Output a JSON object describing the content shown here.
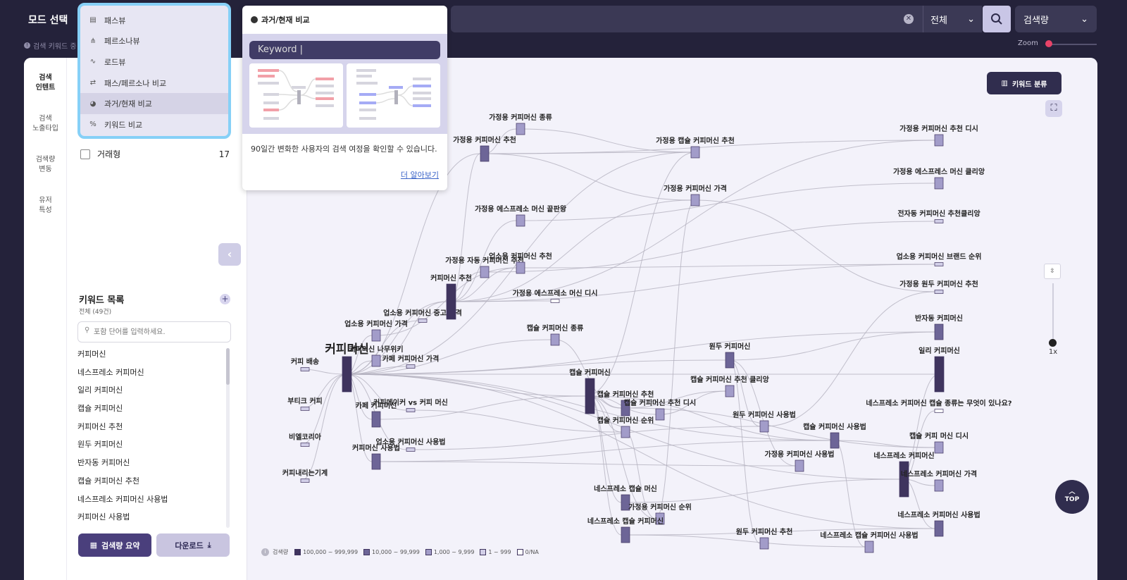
{
  "topbar": {
    "mode_title": "모드 선택",
    "hint": "검색 키워드 중",
    "scope": "전체",
    "metric": "검색량",
    "zoom_label": "Zoom"
  },
  "rail": [
    "검색\n인텐트",
    "검색\n노출타입",
    "검색량\n변동",
    "유저\n특성"
  ],
  "mode_menu": [
    {
      "label": "패스뷰",
      "icon": "path-view-icon"
    },
    {
      "label": "페르소나뷰",
      "icon": "persona-view-icon"
    },
    {
      "label": "로드뷰",
      "icon": "road-view-icon"
    },
    {
      "label": "패스/페르소나 비교",
      "icon": "compare-icon"
    },
    {
      "label": "과거/현재 비교",
      "icon": "history-icon"
    },
    {
      "label": "키워드 비교",
      "icon": "keyword-compare-icon"
    }
  ],
  "popover": {
    "title": "과거/현재 비교",
    "input": "Keyword |",
    "description": "90일간 변화한 사용자의 검색 여정을 확인할 수 있습니다.",
    "link": "더 알아보기"
  },
  "filter": {
    "label": "거래형",
    "count": "17"
  },
  "keywords": {
    "title": "키워드 목록",
    "subtitle": "전체 (49건)",
    "search_placeholder": "포함 단어를 입력하세요.",
    "items": [
      "커피머신",
      "네스프레소 커피머신",
      "일리 커피머신",
      "캡슐 커피머신",
      "커피머신 추천",
      "원두 커피머신",
      "반자동 커피머신",
      "캡슐 커피머신 추천",
      "네스프레소 커피머신 사용법",
      "커피머신 사용법"
    ]
  },
  "buttons": {
    "summary": "검색량 요약",
    "download": "다운로드"
  },
  "graph": {
    "classify_button": "키워드 분류",
    "zoom_value": "1x",
    "top_button": "TOP",
    "legend_title": "검색량",
    "legend": [
      {
        "label": "100,000 ~ 999,999",
        "color": "#3f345e"
      },
      {
        "label": "10,000 ~ 99,999",
        "color": "#6d6597"
      },
      {
        "label": "1,000 ~ 9,999",
        "color": "#a29cc9"
      },
      {
        "label": "1 ~ 999",
        "color": "#d1cee7"
      },
      {
        "label": "0/NA",
        "color": "#ffffff"
      }
    ],
    "nodes": [
      {
        "id": "n0",
        "label": "커피머신",
        "level": 0
      },
      {
        "id": "n1",
        "label": "커피 배송",
        "level": 3
      },
      {
        "id": "n2",
        "label": "부티크 커피",
        "level": 3
      },
      {
        "id": "n3",
        "label": "비엘코리아",
        "level": 3
      },
      {
        "id": "n4",
        "label": "커피내리는기계",
        "level": 3
      },
      {
        "id": "n5",
        "label": "업소용 커피머신 중고 가격",
        "level": 3
      },
      {
        "id": "n6",
        "label": "업소용 커피머신 가격",
        "level": 2
      },
      {
        "id": "n7",
        "label": "커피머신 나무위키",
        "level": 2
      },
      {
        "id": "n8",
        "label": "카페 커피머신 가격",
        "level": 3
      },
      {
        "id": "n9",
        "label": "커피메이커 vs 커피 머신",
        "level": 3
      },
      {
        "id": "n10",
        "label": "카페 커피머신",
        "level": 1
      },
      {
        "id": "n11",
        "label": "업소용 커피머신 사용법",
        "level": 3
      },
      {
        "id": "n12",
        "label": "커피머신 사용법",
        "level": 1
      },
      {
        "id": "n13",
        "label": "커피머신 추천",
        "level": 0
      },
      {
        "id": "n14",
        "label": "가정용 자동 커피머신 추천",
        "level": 2
      },
      {
        "id": "n15",
        "label": "업소용 커피머신 추천",
        "level": 2
      },
      {
        "id": "n16",
        "label": "가정용 에스프레소 머신 끝판왕",
        "level": 2
      },
      {
        "id": "n17",
        "label": "가정용 에스프레소 머신 디시",
        "level": 4
      },
      {
        "id": "n18",
        "label": "가정용 커피머신 추천",
        "level": 1
      },
      {
        "id": "n19",
        "label": "가정용 커피머신 종류",
        "level": 2
      },
      {
        "id": "n20",
        "label": "가정용 캡슐 커피머신 추천",
        "level": 2
      },
      {
        "id": "n21",
        "label": "가정용 커피머신 가격",
        "level": 2
      },
      {
        "id": "n22",
        "label": "캡슐 커피머신 종류",
        "level": 2
      },
      {
        "id": "n23",
        "label": "캡슐 커피머신",
        "level": 0
      },
      {
        "id": "n24",
        "label": "캡슐 커피머신 추천",
        "level": 1
      },
      {
        "id": "n25",
        "label": "캡슐 커피머신 추천 디시",
        "level": 2
      },
      {
        "id": "n26",
        "label": "캡슐 커피머신 순위",
        "level": 2
      },
      {
        "id": "n27",
        "label": "원두 커피머신",
        "level": 1
      },
      {
        "id": "n28",
        "label": "캡슐 커피머신 추천 클리앙",
        "level": 2
      },
      {
        "id": "n29",
        "label": "원두 커피머신 사용법",
        "level": 2
      },
      {
        "id": "n30",
        "label": "캡슐 커피머신 사용법",
        "level": 1
      },
      {
        "id": "n31",
        "label": "가정용 커피머신 사용법",
        "level": 2
      },
      {
        "id": "n32",
        "label": "네스프레소 캡슐 머신",
        "level": 1
      },
      {
        "id": "n33",
        "label": "가정용 커피머신 순위",
        "level": 2
      },
      {
        "id": "n34",
        "label": "네스프레소 캡슐 커피머신",
        "level": 1
      },
      {
        "id": "n35",
        "label": "원두 커피머신 추천",
        "level": 2
      },
      {
        "id": "n36",
        "label": "네스프레소 캡슐 커피머신 사용법",
        "level": 2
      },
      {
        "id": "n37",
        "label": "가정용 커피머신 추천 디시",
        "level": 2
      },
      {
        "id": "n38",
        "label": "가정용 에스프레스 머신 클리앙",
        "level": 2
      },
      {
        "id": "n39",
        "label": "전자동 커피머신 추천클리앙",
        "level": 3
      },
      {
        "id": "n40",
        "label": "업소용 커피머신 브랜드 순위",
        "level": 3
      },
      {
        "id": "n41",
        "label": "가정용 원두 커피머신 추천",
        "level": 3
      },
      {
        "id": "n42",
        "label": "반자동 커피머신",
        "level": 1
      },
      {
        "id": "n43",
        "label": "일리 커피머신",
        "level": 0
      },
      {
        "id": "n44",
        "label": "네스프레소 커피머신 캡슐 종류는 무엇이 있나요?",
        "level": 4
      },
      {
        "id": "n45",
        "label": "캡슐 커피 머신 디시",
        "level": 2
      },
      {
        "id": "n46",
        "label": "네스프레소 커피머신",
        "level": 0
      },
      {
        "id": "n47",
        "label": "네스프레소 커피머신 가격",
        "level": 2
      },
      {
        "id": "n48",
        "label": "네스프레소 커피머신 사용법",
        "level": 1
      }
    ],
    "links": [
      [
        "n0",
        "n1"
      ],
      [
        "n0",
        "n2"
      ],
      [
        "n0",
        "n3"
      ],
      [
        "n0",
        "n4"
      ],
      [
        "n0",
        "n5"
      ],
      [
        "n0",
        "n6"
      ],
      [
        "n0",
        "n7"
      ],
      [
        "n0",
        "n8"
      ],
      [
        "n0",
        "n9"
      ],
      [
        "n0",
        "n10"
      ],
      [
        "n0",
        "n11"
      ],
      [
        "n0",
        "n12"
      ],
      [
        "n0",
        "n13"
      ],
      [
        "n0",
        "n23"
      ],
      [
        "n0",
        "n27"
      ],
      [
        "n0",
        "n42"
      ],
      [
        "n0",
        "n43"
      ],
      [
        "n0",
        "n46"
      ],
      [
        "n0",
        "n18"
      ],
      [
        "n0",
        "n20"
      ],
      [
        "n0",
        "n22"
      ],
      [
        "n0",
        "n30"
      ],
      [
        "n0",
        "n48"
      ],
      [
        "n13",
        "n14"
      ],
      [
        "n13",
        "n15"
      ],
      [
        "n13",
        "n16"
      ],
      [
        "n13",
        "n18"
      ],
      [
        "n13",
        "n17"
      ],
      [
        "n13",
        "n21"
      ],
      [
        "n13",
        "n37"
      ],
      [
        "n13",
        "n40"
      ],
      [
        "n18",
        "n19"
      ],
      [
        "n18",
        "n20"
      ],
      [
        "n18",
        "n21"
      ],
      [
        "n18",
        "n37"
      ],
      [
        "n19",
        "n20"
      ],
      [
        "n16",
        "n38"
      ],
      [
        "n14",
        "n39"
      ],
      [
        "n15",
        "n40"
      ],
      [
        "n21",
        "n41"
      ],
      [
        "n23",
        "n24"
      ],
      [
        "n23",
        "n25"
      ],
      [
        "n23",
        "n26"
      ],
      [
        "n23",
        "n30"
      ],
      [
        "n23",
        "n32"
      ],
      [
        "n23",
        "n33"
      ],
      [
        "n23",
        "n34"
      ],
      [
        "n24",
        "n28"
      ],
      [
        "n24",
        "n45"
      ],
      [
        "n25",
        "n28"
      ],
      [
        "n26",
        "n33"
      ],
      [
        "n27",
        "n29"
      ],
      [
        "n27",
        "n35"
      ],
      [
        "n27",
        "n31"
      ],
      [
        "n29",
        "n41"
      ],
      [
        "n30",
        "n36"
      ],
      [
        "n30",
        "n45"
      ],
      [
        "n34",
        "n36"
      ],
      [
        "n34",
        "n48"
      ],
      [
        "n32",
        "n46"
      ],
      [
        "n46",
        "n47"
      ],
      [
        "n46",
        "n48"
      ],
      [
        "n46",
        "n44"
      ],
      [
        "n12",
        "n31"
      ],
      [
        "n12",
        "n30"
      ],
      [
        "n10",
        "n23"
      ],
      [
        "n6",
        "n15"
      ],
      [
        "n7",
        "n13"
      ],
      [
        "n22",
        "n24"
      ],
      [
        "n20",
        "n23"
      ],
      [
        "n21",
        "n33"
      ],
      [
        "n42",
        "n27"
      ],
      [
        "n43",
        "n46"
      ],
      [
        "n11",
        "n29"
      ],
      [
        "n9",
        "n26"
      ]
    ]
  }
}
